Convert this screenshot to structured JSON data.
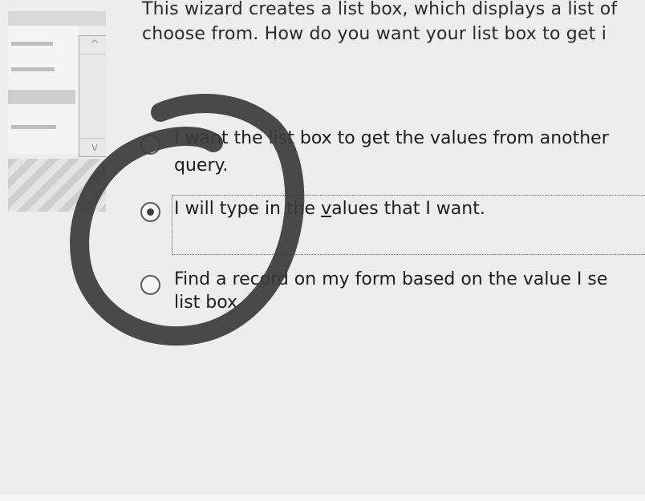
{
  "intro": {
    "line1": "This wizard creates a list box, which displays a list of",
    "line2": "choose from.  How do you want your list box to get i"
  },
  "options": [
    {
      "line1": "I want the list box to get the values from another",
      "line2": "query.",
      "selected": false
    },
    {
      "pre": "I will type in the ",
      "accel": "v",
      "post": "alues that I want.",
      "selected": true
    },
    {
      "line1": "Find a record on my form based on the value I se",
      "line2": "list box.",
      "selected": false
    }
  ],
  "preview": {
    "scroll_up_glyph": "^",
    "scroll_down_glyph": "v"
  },
  "colors": {
    "background": "#ededed",
    "annotation": "#3b3b3b"
  }
}
